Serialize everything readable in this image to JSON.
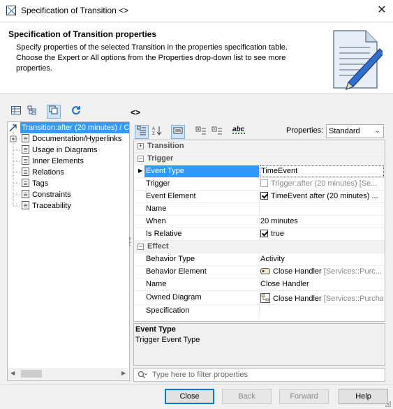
{
  "window": {
    "title": "Specification of Transition <>",
    "close_glyph": "✕"
  },
  "header": {
    "title": "Specification of Transition properties",
    "description": "Specify properties of the selected Transition in the properties specification table. Choose the Expert or All options from the Properties drop-down list to see more properties."
  },
  "left_toolbar": {
    "icons": [
      "table-view-icon",
      "tree-view-icon",
      "copy-icon",
      "refresh-icon"
    ]
  },
  "element_name": "<>",
  "tree": {
    "root": "Transition:after (20 minutes) / C",
    "items": [
      "Documentation/Hyperlinks",
      "Usage in Diagrams",
      "Inner Elements",
      "Relations",
      "Tags",
      "Constraints",
      "Traceability"
    ]
  },
  "right_toolbar": {
    "icons": [
      "categorized-icon",
      "sort-alpha-icon",
      "description-toggle-icon",
      "expand-all-icon",
      "collapse-all-icon",
      "spellcheck-icon"
    ],
    "spellcheck_label": "abc",
    "properties_label": "Properties:",
    "properties_value": "Standard"
  },
  "grid": {
    "sections": {
      "transition": "Transition",
      "trigger": "Trigger",
      "effect": "Effect"
    },
    "trigger_rows": [
      {
        "name": "Event Type",
        "value": "TimeEvent"
      },
      {
        "name": "Trigger",
        "value": "Trigger:after (20 minutes) [Se..."
      },
      {
        "name": "Event Element",
        "value": "TimeEvent after (20 minutes) ..."
      },
      {
        "name": "Name",
        "value": ""
      },
      {
        "name": "When",
        "value": "20 minutes"
      },
      {
        "name": "Is Relative",
        "value": "true"
      }
    ],
    "effect_rows": [
      {
        "name": "Behavior Type",
        "value": "Activity"
      },
      {
        "name": "Behavior Element",
        "value": "Close Handler",
        "extra": "[Services::Purc..."
      },
      {
        "name": "Name",
        "value": "Close Handler"
      },
      {
        "name": "Owned Diagram",
        "value": "Close Handler",
        "extra": "[Services::Purchas"
      },
      {
        "name": "Specification",
        "value": ""
      }
    ]
  },
  "description_panel": {
    "title": "Event Type",
    "text": "Trigger Event Type"
  },
  "filter": {
    "placeholder": "Type here to filter properties"
  },
  "buttons": {
    "close": "Close",
    "back": "Back",
    "forward": "Forward",
    "help": "Help"
  }
}
